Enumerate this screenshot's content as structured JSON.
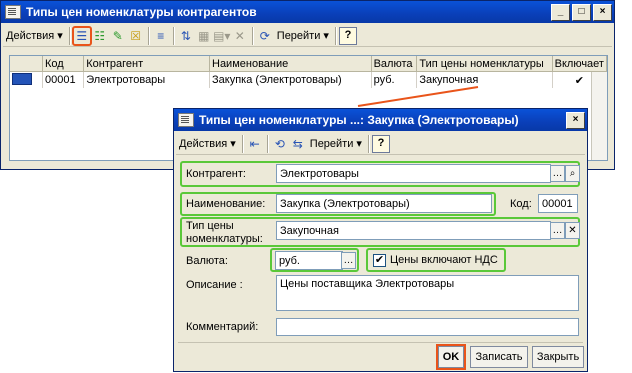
{
  "main_window": {
    "title": "Типы цен номенклатуры контрагентов",
    "toolbar": {
      "actions_label": "Действия",
      "goto_label": "Перейти",
      "help_label": "?"
    },
    "columns": [
      "Код",
      "Контрагент",
      "Наименование",
      "Валюта",
      "Тип цены номенклатуры",
      "Включает"
    ],
    "row": {
      "code": "00001",
      "counterparty": "Электротовары",
      "name": "Закупка (Электротовары)",
      "currency": "руб.",
      "price_type": "Закупочная",
      "includes_vat": "✔"
    }
  },
  "dialog": {
    "title": "Типы цен номенклатуры ...: Закупка (Электротовары)",
    "toolbar": {
      "actions_label": "Действия",
      "goto_label": "Перейти",
      "help_label": "?"
    },
    "fields": {
      "counterparty_label": "Контрагент:",
      "counterparty_value": "Электротовары",
      "name_label": "Наименование:",
      "name_value": "Закупка (Электротовары)",
      "code_label": "Код:",
      "code_value": "00001",
      "price_type_label_1": "Тип цены",
      "price_type_label_2": "номенклатуры:",
      "price_type_value": "Закупочная",
      "currency_label": "Валюта:",
      "currency_value": "руб.",
      "vat_label": "Цены включают НДС",
      "vat_checked": true,
      "description_label": "Описание :",
      "description_value": "Цены поставщика Электротовары",
      "comment_label": "Комментарий:",
      "comment_value": ""
    },
    "buttons": {
      "ok": "OK",
      "save": "Записать",
      "close": "Закрыть"
    }
  },
  "colors": {
    "title_bar": "#0a4fd0",
    "window_bg": "#ece9d8",
    "highlight_orange": "#e9541a",
    "highlight_green": "#5ac839"
  }
}
